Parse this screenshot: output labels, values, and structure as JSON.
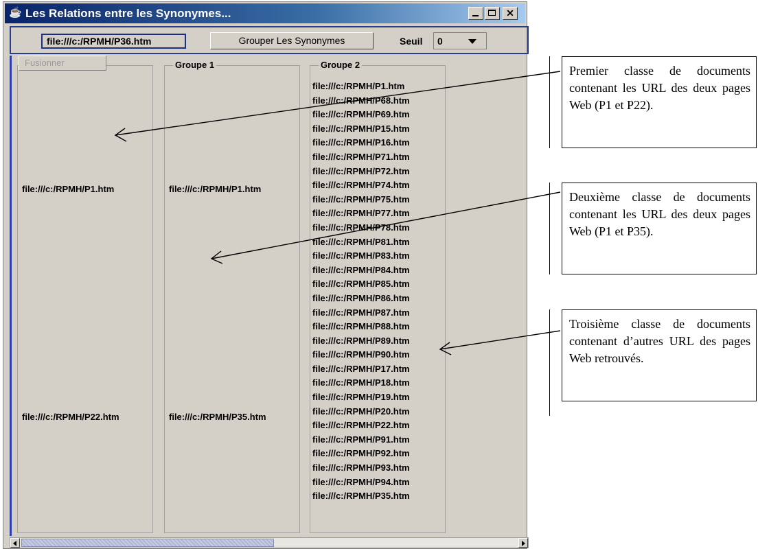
{
  "window": {
    "title": "Les Relations entre les Synonymes...",
    "icon": "java-cup-icon",
    "controls": {
      "minimize_icon": "minimize-icon",
      "maximize_icon": "maximize-icon",
      "close_label": "✕"
    }
  },
  "toolbar": {
    "url_value": "file:///c:/RPMH/P36.htm",
    "group_button_label": "Grouper Les Synonymes",
    "seuil_label": "Seuil",
    "seuil_value": "0"
  },
  "fusion_button_label": "Fusionner",
  "panels": [
    {
      "title": "",
      "entries": [
        "file:///c:/RPMH/P1.htm",
        "file:///c:/RPMH/P22.htm"
      ]
    },
    {
      "title": "Groupe 1",
      "entries": [
        "file:///c:/RPMH/P1.htm",
        "file:///c:/RPMH/P35.htm"
      ]
    },
    {
      "title": "Groupe 2",
      "entries": [
        "file:///c:/RPMH/P1.htm",
        "file:///c:/RPMH/P68.htm",
        "file:///c:/RPMH/P69.htm",
        "file:///c:/RPMH/P15.htm",
        "file:///c:/RPMH/P16.htm",
        "file:///c:/RPMH/P71.htm",
        "file:///c:/RPMH/P72.htm",
        "file:///c:/RPMH/P74.htm",
        "file:///c:/RPMH/P75.htm",
        "file:///c:/RPMH/P77.htm",
        "file:///c:/RPMH/P78.htm",
        "file:///c:/RPMH/P81.htm",
        "file:///c:/RPMH/P83.htm",
        "file:///c:/RPMH/P84.htm",
        "file:///c:/RPMH/P85.htm",
        "file:///c:/RPMH/P86.htm",
        "file:///c:/RPMH/P87.htm",
        "file:///c:/RPMH/P88.htm",
        "file:///c:/RPMH/P89.htm",
        "file:///c:/RPMH/P90.htm",
        "file:///c:/RPMH/P17.htm",
        "file:///c:/RPMH/P18.htm",
        "file:///c:/RPMH/P19.htm",
        "file:///c:/RPMH/P20.htm",
        "file:///c:/RPMH/P22.htm",
        "file:///c:/RPMH/P91.htm",
        "file:///c:/RPMH/P92.htm",
        "file:///c:/RPMH/P93.htm",
        "file:///c:/RPMH/P94.htm",
        "file:///c:/RPMH/P35.htm"
      ]
    }
  ],
  "annotations": [
    "Premier classe de documents contenant les URL des deux pages Web (P1 et P22).",
    "Deuxième classe de documents contenant les URL des deux pages Web (P1 et P35).",
    "Troisième classe de documents contenant d’autres URL des pages Web retrouvés."
  ]
}
